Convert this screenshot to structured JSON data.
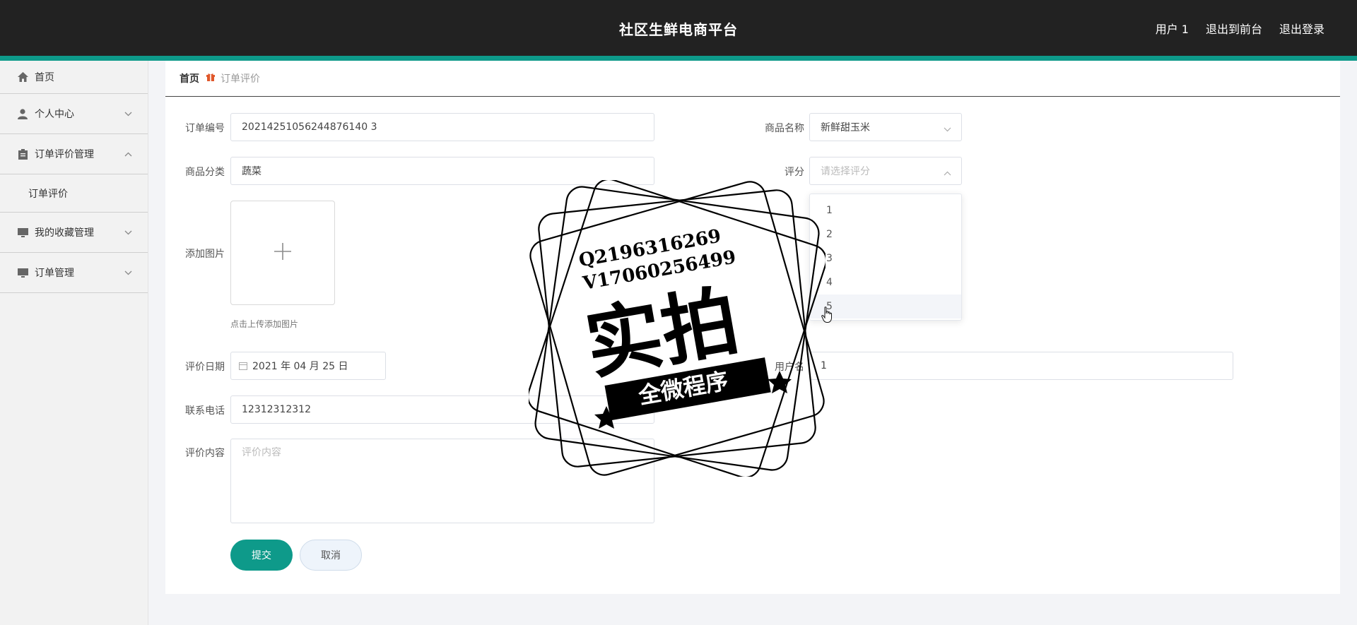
{
  "header": {
    "title": "社区生鲜电商平台",
    "user": "用户 1",
    "to_front": "退出到前台",
    "logout": "退出登录"
  },
  "sidebar": {
    "items": [
      {
        "label": "首页",
        "icon": "home-icon"
      },
      {
        "label": "个人中心",
        "icon": "user-icon"
      },
      {
        "label": "订单评价管理",
        "icon": "clipboard-icon"
      },
      {
        "label": "订单评价",
        "icon": ""
      },
      {
        "label": "我的收藏管理",
        "icon": "monitor-icon"
      },
      {
        "label": "订单管理",
        "icon": "monitor-icon"
      }
    ]
  },
  "breadcrumb": {
    "home": "首页",
    "current": "订单评价"
  },
  "form": {
    "order_no_label": "订单编号",
    "order_no": "20214251056244876140 3",
    "category_label": "商品分类",
    "category": "蔬菜",
    "image_label": "添加图片",
    "image_hint": "点击上传添加图片",
    "date_label": "评价日期",
    "date": "2021 年 04 月 25 日",
    "phone_label": "联系电话",
    "phone": "12312312312",
    "content_label": "评价内容",
    "content_placeholder": "评价内容",
    "product_label": "商品名称",
    "product": "新鲜甜玉米",
    "rating_label": "评分",
    "rating_placeholder": "请选择评分",
    "username_label": "用户名",
    "username": "1",
    "rating_options": [
      "1",
      "2",
      "3",
      "4",
      "5"
    ]
  },
  "buttons": {
    "submit": "提交",
    "cancel": "取消"
  },
  "watermark": {
    "line1": "Q2196316269",
    "line2": "V17060256499",
    "big": "实拍",
    "ribbon": "全微程序"
  },
  "colors": {
    "accent": "#0e9a8a",
    "header_bg": "#222222"
  }
}
